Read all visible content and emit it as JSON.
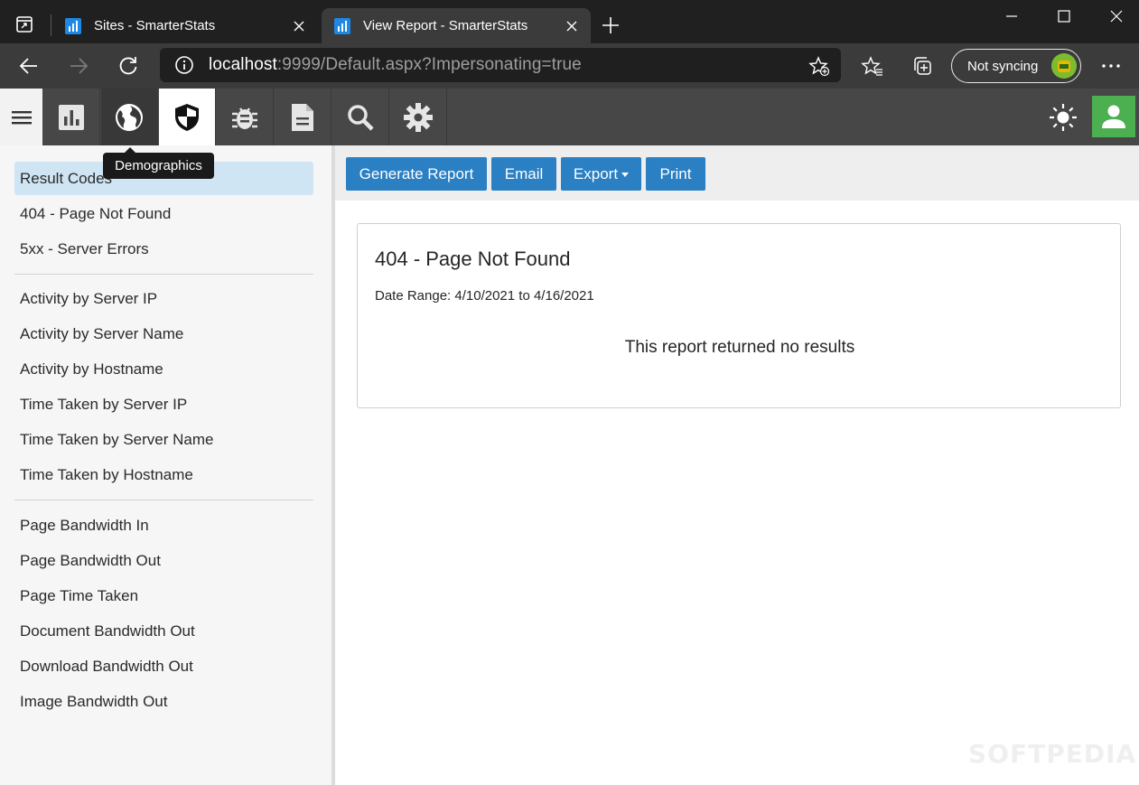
{
  "browser": {
    "tabs": [
      {
        "title": "Sites - SmarterStats",
        "active": false
      },
      {
        "title": "View Report - SmarterStats",
        "active": true
      }
    ],
    "url_host": "localhost",
    "url_rest": ":9999/Default.aspx?Impersonating=true",
    "sync_label": "Not syncing"
  },
  "app": {
    "nav_icons": [
      "reports-icon",
      "globe-icon",
      "shield-icon",
      "bug-icon",
      "document-icon",
      "search-icon",
      "gear-icon"
    ],
    "active_nav": "shield-icon",
    "tooltip": "Demographics",
    "accent_color": "#2b7fc3",
    "user_color": "#4caf50"
  },
  "sidebar": {
    "groups": [
      [
        "Result Codes",
        "404 - Page Not Found",
        "5xx - Server Errors"
      ],
      [
        "Activity by Server IP",
        "Activity by Server Name",
        "Activity by Hostname",
        "Time Taken by Server IP",
        "Time Taken by Server Name",
        "Time Taken by Hostname"
      ],
      [
        "Page Bandwidth In",
        "Page Bandwidth Out",
        "Page Time Taken",
        "Document Bandwidth Out",
        "Download Bandwidth Out",
        "Image Bandwidth Out"
      ]
    ],
    "selected": "Result Codes"
  },
  "toolbar": {
    "generate_label": "Generate Report",
    "email_label": "Email",
    "export_label": "Export",
    "print_label": "Print"
  },
  "report": {
    "title": "404 - Page Not Found",
    "date_range": "Date Range: 4/10/2021 to 4/16/2021",
    "empty_message": "This report returned no results"
  },
  "watermark": "SOFTPEDIA"
}
